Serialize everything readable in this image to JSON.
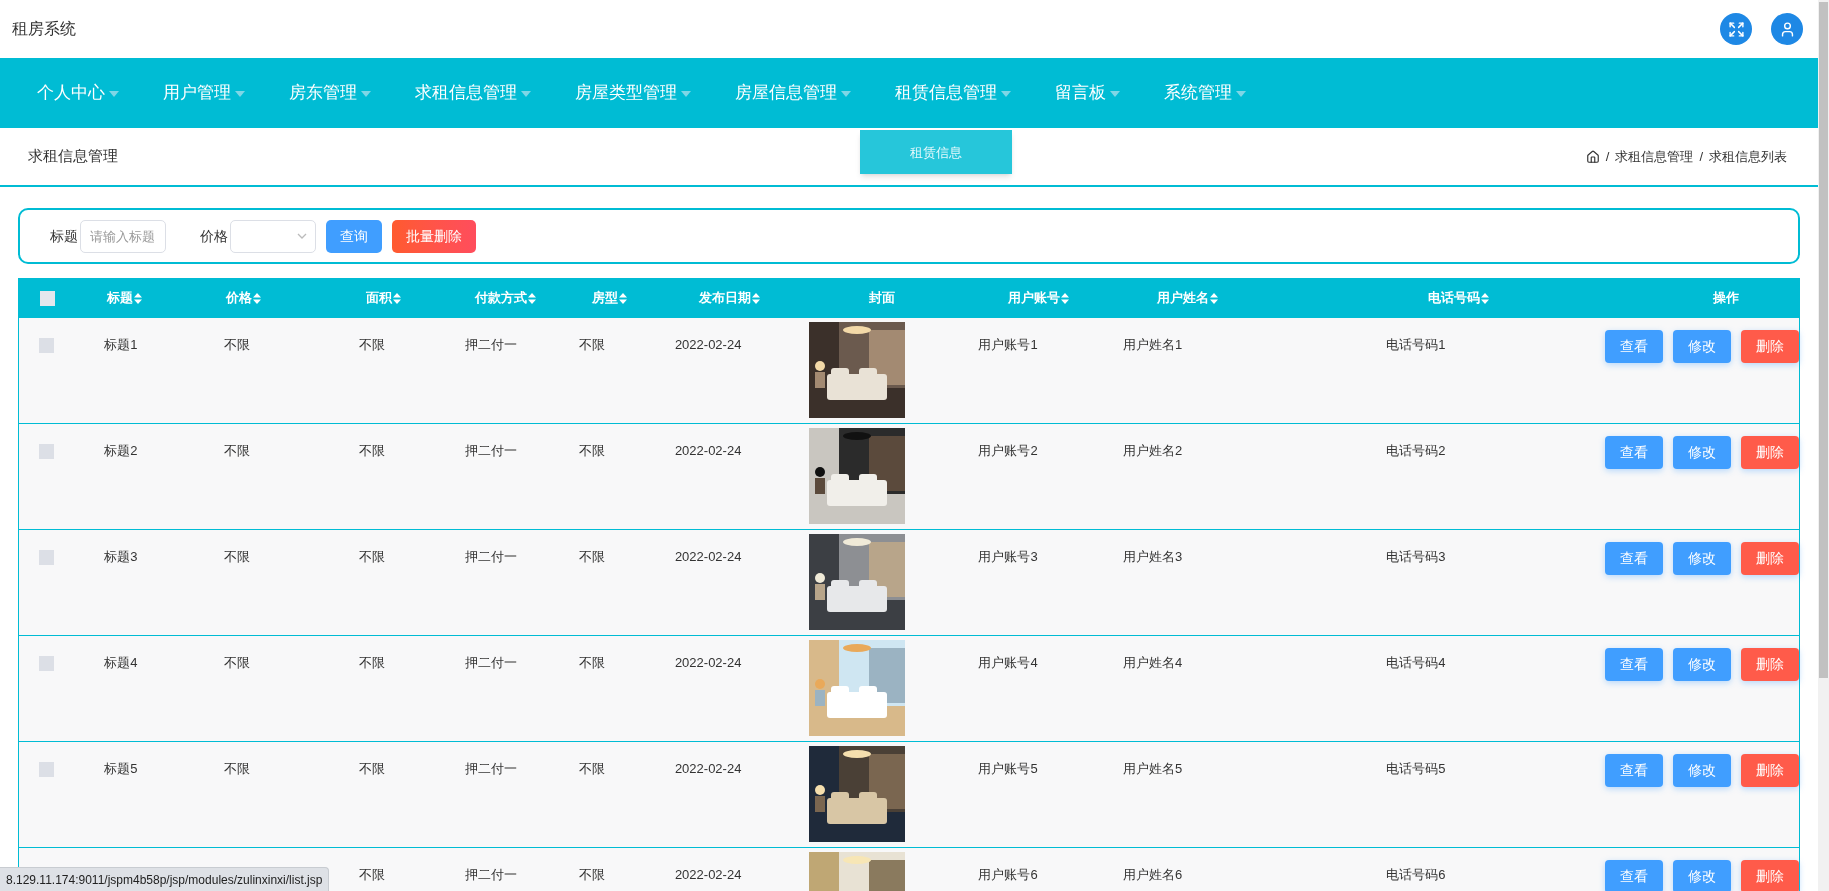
{
  "app_title": "租房系统",
  "nav": [
    {
      "label": "个人中心"
    },
    {
      "label": "用户管理"
    },
    {
      "label": "房东管理"
    },
    {
      "label": "求租信息管理"
    },
    {
      "label": "房屋类型管理"
    },
    {
      "label": "房屋信息管理"
    },
    {
      "label": "租赁信息管理",
      "submenu": [
        "租赁信息"
      ]
    },
    {
      "label": "留言板"
    },
    {
      "label": "系统管理"
    }
  ],
  "page_title": "求租信息管理",
  "breadcrumb": [
    {
      "separator": "/",
      "label": "求租信息管理"
    },
    {
      "separator": "/",
      "label": "求租信息列表"
    }
  ],
  "search": {
    "fields": [
      {
        "label": "标题",
        "kind": "text",
        "placeholder": "请输入标题"
      },
      {
        "label": "价格",
        "kind": "select"
      }
    ],
    "buttons": [
      {
        "label": "查询",
        "kind": "primary"
      },
      {
        "label": "批量删除",
        "kind": "danger"
      }
    ]
  },
  "table": {
    "header_checkbox": {
      "checked": false
    },
    "columns": [
      {
        "label": "标题",
        "sortable": true
      },
      {
        "label": "价格",
        "sortable": true
      },
      {
        "label": "面积",
        "sortable": true
      },
      {
        "label": "付款方式",
        "sortable": true
      },
      {
        "label": "房型",
        "sortable": true
      },
      {
        "label": "发布日期",
        "sortable": true
      },
      {
        "label": "封面",
        "sortable": false
      },
      {
        "label": "用户账号",
        "sortable": true
      },
      {
        "label": "用户姓名",
        "sortable": true
      },
      {
        "label": "电话号码",
        "sortable": true
      },
      {
        "label": "操作",
        "sortable": false
      }
    ],
    "rows": [
      {
        "checked": false,
        "title": "标题1",
        "price": "不限",
        "area": "不限",
        "payment": "押二付一",
        "room_type": "不限",
        "date": "2022-02-24",
        "account": "用户账号1",
        "name": "用户姓名1",
        "phone": "电话号码1",
        "actions": [
          {
            "label": "查看",
            "kind": "view"
          },
          {
            "label": "修改",
            "kind": "edit"
          },
          {
            "label": "删除",
            "kind": "delete"
          }
        ]
      },
      {
        "checked": false,
        "title": "标题2",
        "price": "不限",
        "area": "不限",
        "payment": "押二付一",
        "room_type": "不限",
        "date": "2022-02-24",
        "account": "用户账号2",
        "name": "用户姓名2",
        "phone": "电话号码2",
        "actions": [
          {
            "label": "查看",
            "kind": "view"
          },
          {
            "label": "修改",
            "kind": "edit"
          },
          {
            "label": "删除",
            "kind": "delete"
          }
        ]
      },
      {
        "checked": false,
        "title": "标题3",
        "price": "不限",
        "area": "不限",
        "payment": "押二付一",
        "room_type": "不限",
        "date": "2022-02-24",
        "account": "用户账号3",
        "name": "用户姓名3",
        "phone": "电话号码3",
        "actions": [
          {
            "label": "查看",
            "kind": "view"
          },
          {
            "label": "修改",
            "kind": "edit"
          },
          {
            "label": "删除",
            "kind": "delete"
          }
        ]
      },
      {
        "checked": false,
        "title": "标题4",
        "price": "不限",
        "area": "不限",
        "payment": "押二付一",
        "room_type": "不限",
        "date": "2022-02-24",
        "account": "用户账号4",
        "name": "用户姓名4",
        "phone": "电话号码4",
        "actions": [
          {
            "label": "查看",
            "kind": "view"
          },
          {
            "label": "修改",
            "kind": "edit"
          },
          {
            "label": "删除",
            "kind": "delete"
          }
        ]
      },
      {
        "checked": false,
        "title": "标题5",
        "price": "不限",
        "area": "不限",
        "payment": "押二付一",
        "room_type": "不限",
        "date": "2022-02-24",
        "account": "用户账号5",
        "name": "用户姓名5",
        "phone": "电话号码5",
        "actions": [
          {
            "label": "查看",
            "kind": "view"
          },
          {
            "label": "修改",
            "kind": "edit"
          },
          {
            "label": "删除",
            "kind": "delete"
          }
        ]
      },
      {
        "area": "不限",
        "payment": "押二付一",
        "room_type": "不限",
        "date": "2022-02-24",
        "account": "用户账号6",
        "name": "用户姓名6",
        "phone": "电话号码6",
        "actions": [
          {
            "label": "查看",
            "kind": "view"
          },
          {
            "label": "修改",
            "kind": "edit"
          },
          {
            "label": "删除",
            "kind": "delete"
          }
        ]
      }
    ]
  },
  "status_url": "8.129.11.174:9011/jspm4b58p/jsp/modules/zulinxinxi/list.jsp"
}
